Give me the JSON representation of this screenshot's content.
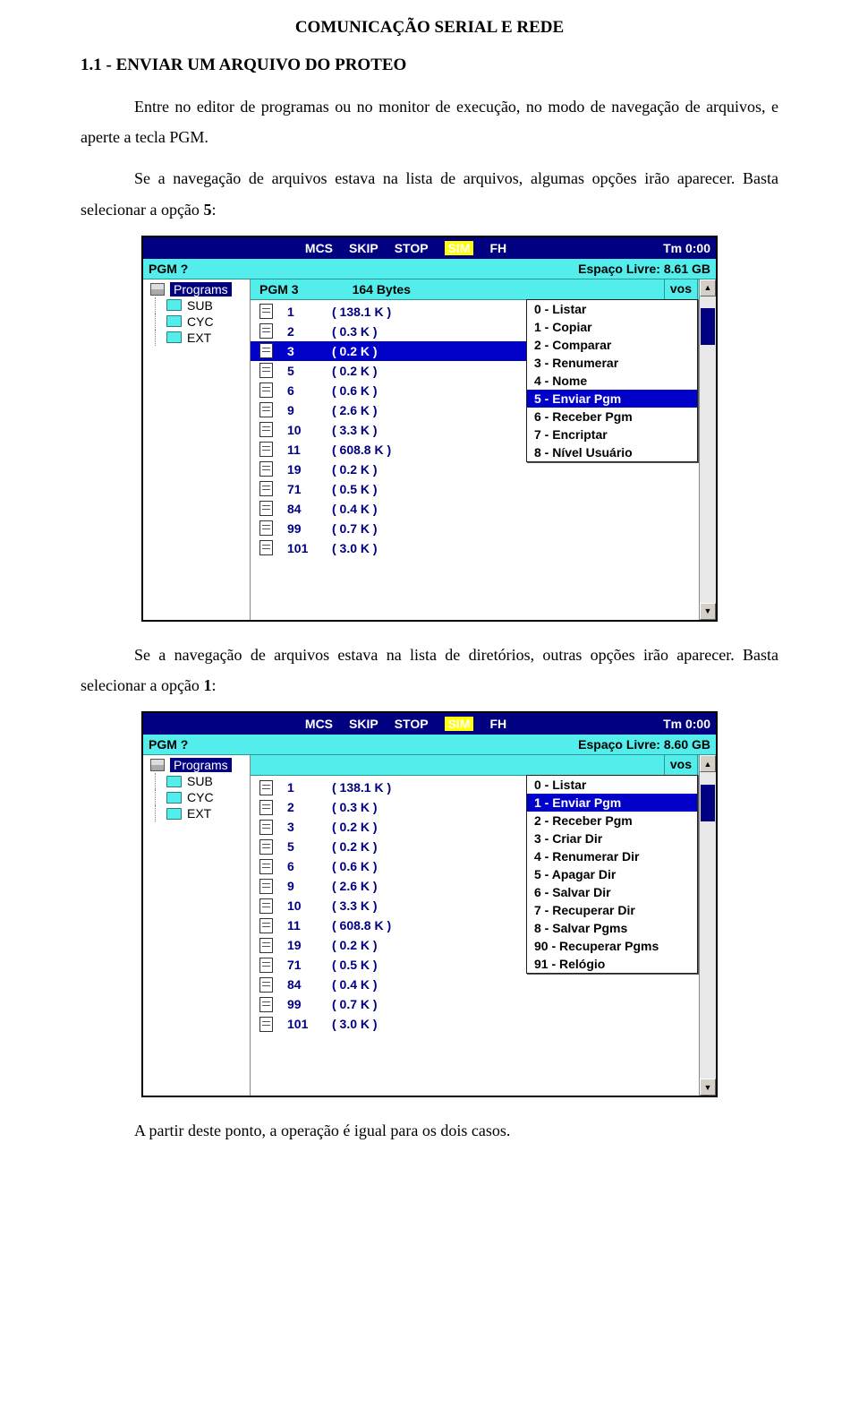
{
  "header": "COMUNICAÇÃO SERIAL E REDE",
  "section_title": "1.1 - ENVIAR UM ARQUIVO DO PROTEO",
  "para1a": "Entre no editor de programas ou no monitor de execução, no modo de navegação de arquivos, e aperte a tecla PGM.",
  "para1b_a": "Se a navegação de arquivos estava na lista de arquivos, algumas opções irão aparecer. Basta selecionar a opção ",
  "para1b_bold": "5",
  "para1b_b": ":",
  "para2_a": "Se a navegação de arquivos estava na lista de diretórios, outras opções irão aparecer. Basta selecionar a opção ",
  "para2_bold": "1",
  "para2_b": ":",
  "para3": "A partir deste ponto, a operação é igual para os dois casos.",
  "status": {
    "mcs": "MCS",
    "skip": "SKIP",
    "stop": "STOP",
    "sim": "SIM",
    "fh": "FH",
    "tm": "Tm  0:00"
  },
  "pgm_prompt": "PGM ?",
  "free_space_1": "Espaço Livre: 8.61 GB",
  "free_space_2": "Espaço Livre: 8.60 GB",
  "vos_label": "vos",
  "tree": {
    "root": "Programs",
    "sub": "SUB",
    "cyc": "CYC",
    "ext": "EXT"
  },
  "file_header": {
    "name": "PGM 3",
    "bytes": "164 Bytes"
  },
  "files": [
    {
      "n": "1",
      "s": "( 138.1 K )"
    },
    {
      "n": "2",
      "s": "(  0.3 K )"
    },
    {
      "n": "3",
      "s": "(  0.2 K )"
    },
    {
      "n": "5",
      "s": "(  0.2 K )"
    },
    {
      "n": "6",
      "s": "(  0.6 K )"
    },
    {
      "n": "9",
      "s": "(  2.6 K )"
    },
    {
      "n": "10",
      "s": "(  3.3 K )"
    },
    {
      "n": "11",
      "s": "( 608.8 K )"
    },
    {
      "n": "19",
      "s": "(  0.2 K )"
    },
    {
      "n": "71",
      "s": "(  0.5 K )"
    },
    {
      "n": "84",
      "s": "(  0.4 K )"
    },
    {
      "n": "99",
      "s": "(  0.7 K )"
    },
    {
      "n": "101",
      "s": "(  3.0 K )"
    }
  ],
  "menu1": [
    "0 - Listar",
    "1 - Copiar",
    "2 - Comparar",
    "3 - Renumerar",
    "4 - Nome",
    "5 - Enviar Pgm",
    "6 - Receber Pgm",
    "7 - Encriptar",
    "8 - Nível Usuário"
  ],
  "menu1_selected": 5,
  "menu2": [
    "0 - Listar",
    "1 - Enviar Pgm",
    "2 - Receber Pgm",
    "3 - Criar Dir",
    "4 - Renumerar Dir",
    "5 - Apagar Dir",
    "6 - Salvar Dir",
    "7 - Recuperar Dir",
    "8 - Salvar Pgms",
    "90 - Recuperar Pgms",
    "91 - Relógio"
  ],
  "menu2_selected": 1,
  "shot1_selected_file": 2,
  "shot2_selected_file": -1,
  "arrows": {
    "up": "▲",
    "down": "▼"
  }
}
